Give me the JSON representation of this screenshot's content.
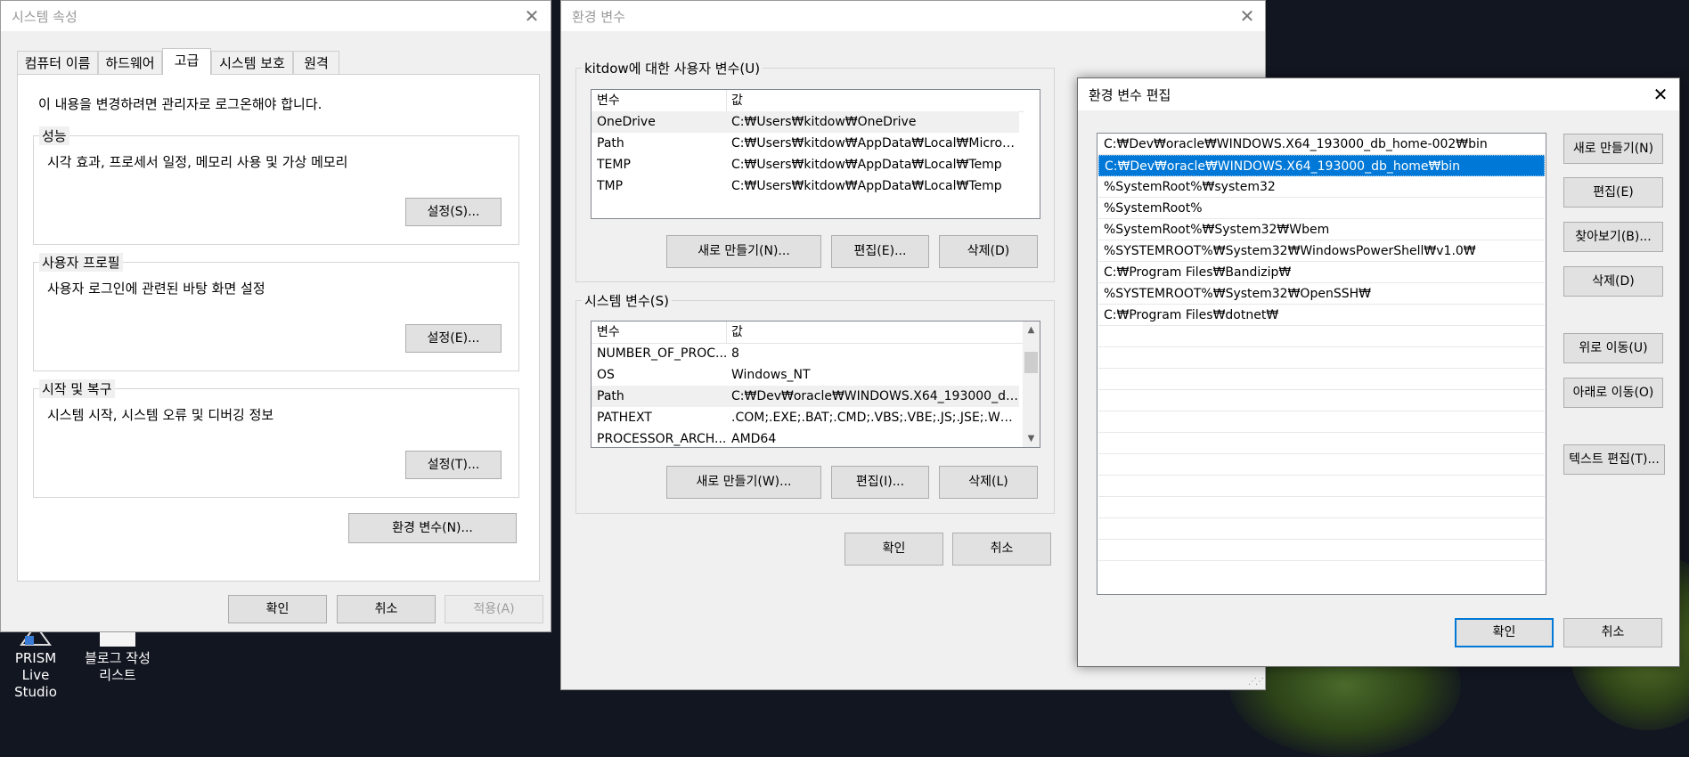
{
  "desktop": {
    "icons": [
      {
        "name": "PRISM Live Studio"
      },
      {
        "name": "블로그 작성 리스트"
      }
    ],
    "icon_labels": {
      "prism_line1": "PRISM Live",
      "prism_line2": "Studio",
      "blog_line1": "블로그 작성",
      "blog_line2": "리스트"
    }
  },
  "system_properties": {
    "title": "시스템 속성",
    "tabs": [
      "컴퓨터 이름",
      "하드웨어",
      "고급",
      "시스템 보호",
      "원격"
    ],
    "active_tab": "고급",
    "admin_note": "이 내용을 변경하려면 관리자로 로그온해야 합니다.",
    "performance": {
      "label": "성능",
      "desc": "시각 효과, 프로세서 일정, 메모리 사용 및 가상 메모리",
      "button": "설정(S)..."
    },
    "user_profile": {
      "label": "사용자 프로필",
      "desc": "사용자 로그인에 관련된 바탕 화면 설정",
      "button": "설정(E)..."
    },
    "startup_recovery": {
      "label": "시작 및 복구",
      "desc": "시스템 시작, 시스템 오류 및 디버깅 정보",
      "button": "설정(T)..."
    },
    "env_button": "환경 변수(N)...",
    "ok": "확인",
    "cancel": "취소",
    "apply": "적용(A)"
  },
  "env_vars": {
    "title": "환경 변수",
    "user_group_label": "kitdow에 대한 사용자 변수(U)",
    "columns": {
      "name": "변수",
      "value": "값"
    },
    "user_vars": [
      {
        "name": "OneDrive",
        "value": "C:₩Users₩kitdow₩OneDrive"
      },
      {
        "name": "Path",
        "value": "C:₩Users₩kitdow₩AppData₩Local₩Microsof..."
      },
      {
        "name": "TEMP",
        "value": "C:₩Users₩kitdow₩AppData₩Local₩Temp"
      },
      {
        "name": "TMP",
        "value": "C:₩Users₩kitdow₩AppData₩Local₩Temp"
      }
    ],
    "user_buttons": {
      "new": "새로 만들기(N)...",
      "edit": "편집(E)...",
      "delete": "삭제(D)"
    },
    "system_group_label": "시스템 변수(S)",
    "system_vars": [
      {
        "name": "NUMBER_OF_PROC...",
        "value": "8"
      },
      {
        "name": "OS",
        "value": "Windows_NT"
      },
      {
        "name": "Path",
        "value": "C:₩Dev₩oracle₩WINDOWS.X64_193000_db_h..."
      },
      {
        "name": "PATHEXT",
        "value": ".COM;.EXE;.BAT;.CMD;.VBS;.VBE;.JS;.JSE;.WSF;...."
      },
      {
        "name": "PROCESSOR_ARCH...",
        "value": "AMD64"
      }
    ],
    "system_buttons": {
      "new": "새로 만들기(W)...",
      "edit": "편집(I)...",
      "delete": "삭제(L)"
    },
    "ok": "확인",
    "cancel": "취소"
  },
  "edit_env": {
    "title": "환경 변수 편집",
    "entries": [
      "C:₩Dev₩oracle₩WINDOWS.X64_193000_db_home-002₩bin",
      "C:₩Dev₩oracle₩WINDOWS.X64_193000_db_home₩bin",
      "%SystemRoot%₩system32",
      "%SystemRoot%",
      "%SystemRoot%₩System32₩Wbem",
      "%SYSTEMROOT%₩System32₩WindowsPowerShell₩v1.0₩",
      "C:₩Program Files₩Bandizip₩",
      "%SYSTEMROOT%₩System32₩OpenSSH₩",
      "C:₩Program Files₩dotnet₩"
    ],
    "selected_index": 1,
    "buttons": {
      "new": "새로 만들기(N)",
      "edit": "편집(E)",
      "browse": "찾아보기(B)...",
      "delete": "삭제(D)",
      "move_up": "위로 이동(U)",
      "move_down": "아래로 이동(O)",
      "edit_text": "텍스트 편집(T)..."
    },
    "ok": "확인",
    "cancel": "취소"
  }
}
